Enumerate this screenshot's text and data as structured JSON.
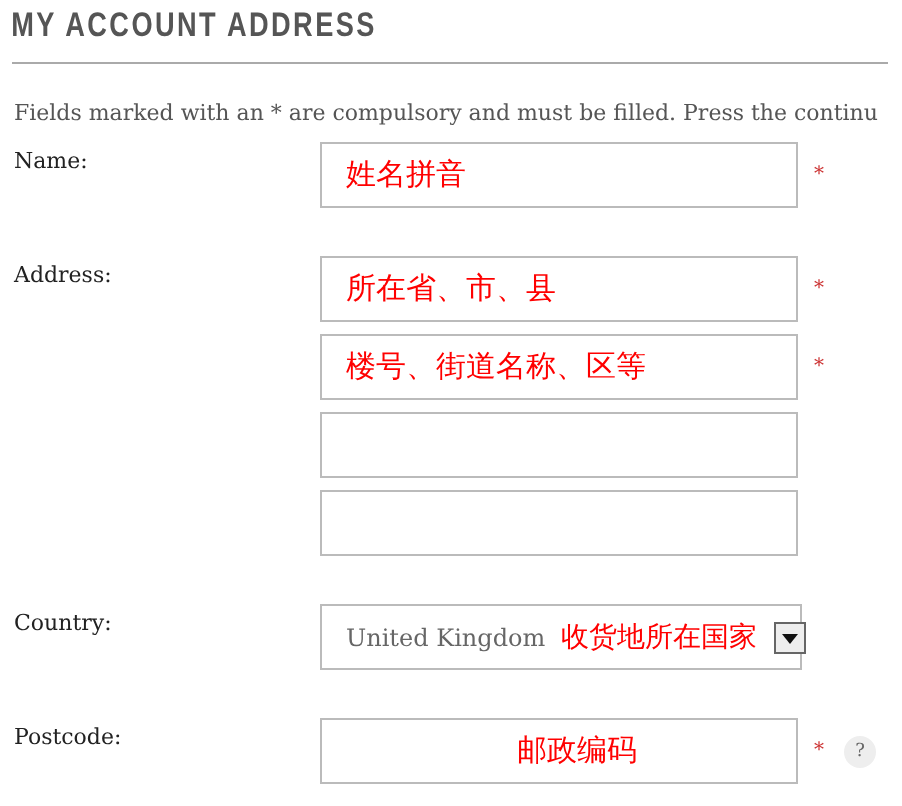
{
  "heading": "MY ACCOUNT ADDRESS",
  "intro": "Fields marked with an * are compulsory and must be filled. Press the continu",
  "rows": [
    {
      "label": "Name:",
      "fields": [
        {
          "kind": "text",
          "value": "姓名拼音",
          "required_mark": "*"
        }
      ]
    },
    {
      "label": "Address:",
      "fields": [
        {
          "kind": "text",
          "value": "所在省、市、县",
          "required_mark": "*"
        },
        {
          "kind": "text",
          "value": "楼号、街道名称、区等",
          "required_mark": "*"
        },
        {
          "kind": "text"
        },
        {
          "kind": "text"
        }
      ]
    },
    {
      "label": "Country:",
      "fields": [
        {
          "kind": "select",
          "value": "United Kingdom",
          "note": "收货地所在国家"
        }
      ]
    },
    {
      "label": "Postcode:",
      "fields": [
        {
          "kind": "text",
          "value": "邮政编码",
          "centered": true,
          "required_mark": "*",
          "help": "?"
        }
      ]
    }
  ]
}
